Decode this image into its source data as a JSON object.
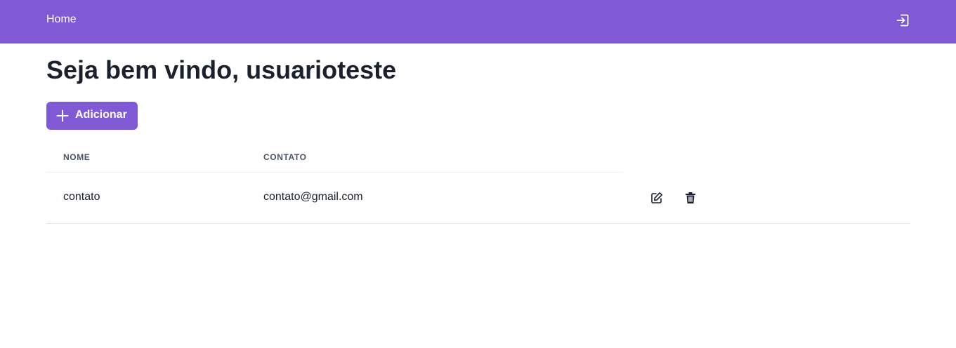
{
  "header": {
    "home_label": "Home",
    "logout_icon": "logout-icon"
  },
  "main": {
    "title": "Seja bem vindo, usuarioteste",
    "add_button_label": "Adicionar",
    "add_button_icon": "plus-icon"
  },
  "table": {
    "columns": [
      "NOME",
      "CONTATO"
    ],
    "rows": [
      {
        "nome": "contato",
        "contato": "contato@gmail.com",
        "actions": [
          "edit-icon",
          "trash-icon"
        ]
      }
    ]
  },
  "colors": {
    "accent": "#805ad5",
    "text": "#1a202c",
    "muted": "#4a5568"
  }
}
